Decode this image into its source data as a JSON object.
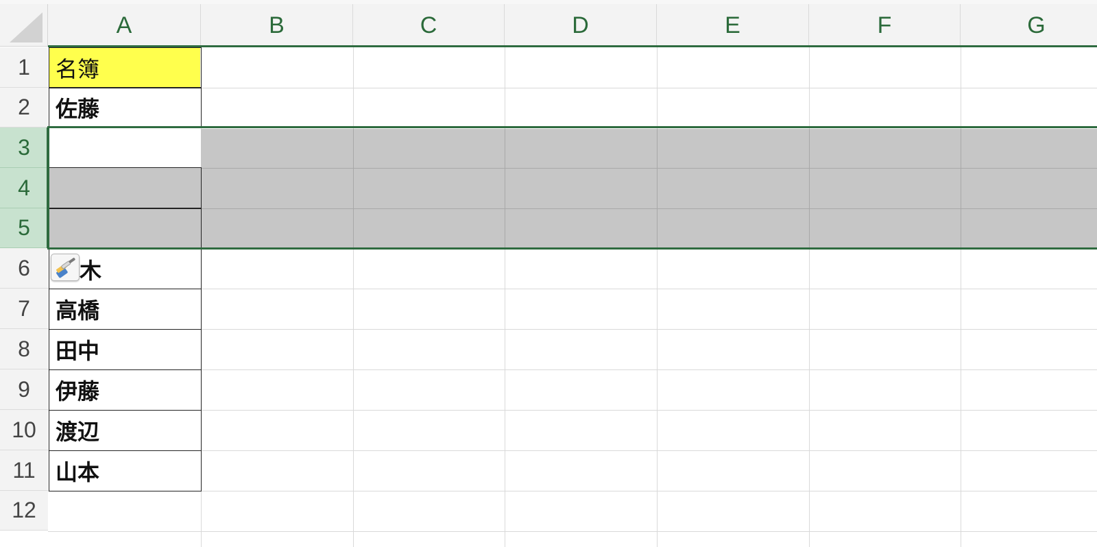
{
  "columns": [
    "A",
    "B",
    "C",
    "D",
    "E",
    "F",
    "G"
  ],
  "rows": [
    "1",
    "2",
    "3",
    "4",
    "5",
    "6",
    "7",
    "8",
    "9",
    "10",
    "11",
    "12"
  ],
  "cells": {
    "a1": "名簿",
    "a2": "佐藤",
    "a6": "木",
    "a7": "高橋",
    "a8": "田中",
    "a9": "伊藤",
    "a10": "渡辺",
    "a11": "山本"
  },
  "selected_rows": [
    "3",
    "4",
    "5"
  ],
  "colors": {
    "accent_green": "#2e6b3f",
    "header_fill_yellow": "#ffff4d",
    "selection_gray": "#c6c6c6",
    "row_header_selected": "#c8e2cf"
  },
  "icons": {
    "paste_options": "paintbrush-icon"
  }
}
